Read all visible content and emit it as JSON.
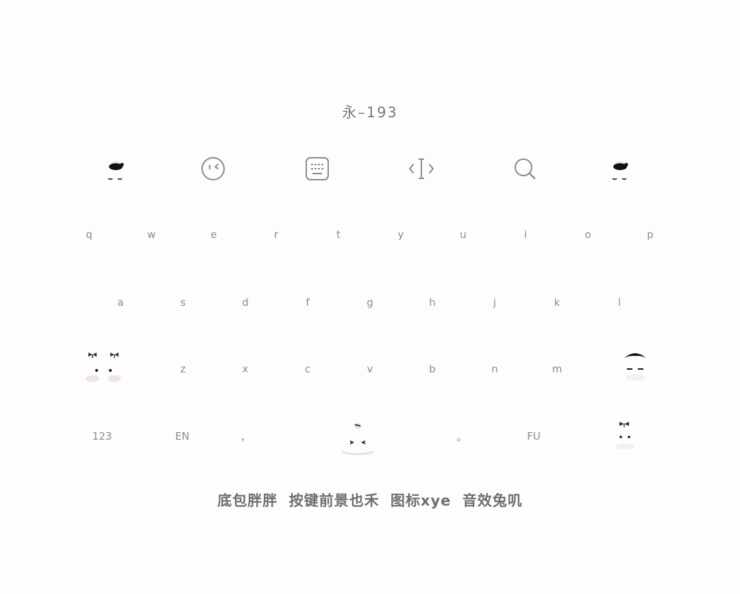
{
  "title": "永–193",
  "toolbar": {
    "left_mascot_icon": "mascot-bun-icon",
    "emoji_icon": "wink-face-icon",
    "keyboard_icon": "keyboard-icon",
    "cursor_icon": "text-cursor-icon",
    "search_icon": "search-icon",
    "right_mascot_icon": "mascot-bun-icon"
  },
  "rows": {
    "row1": [
      "q",
      "w",
      "e",
      "r",
      "t",
      "y",
      "u",
      "i",
      "o",
      "p"
    ],
    "row2": [
      "a",
      "s",
      "d",
      "f",
      "g",
      "h",
      "j",
      "k",
      "l"
    ],
    "row3": [
      "z",
      "x",
      "c",
      "v",
      "b",
      "n",
      "m"
    ]
  },
  "bottom": {
    "num_label": "123",
    "lang_label": "EN",
    "comma_label": "，",
    "period_label": "。",
    "fu_label": "FU"
  },
  "footer": "底包胖胖 按键前景也禾 图标xye 音效兔叽",
  "colors": {
    "background": "#fdfdfd",
    "text": "#8c8c8c",
    "mascot": "#111111"
  }
}
